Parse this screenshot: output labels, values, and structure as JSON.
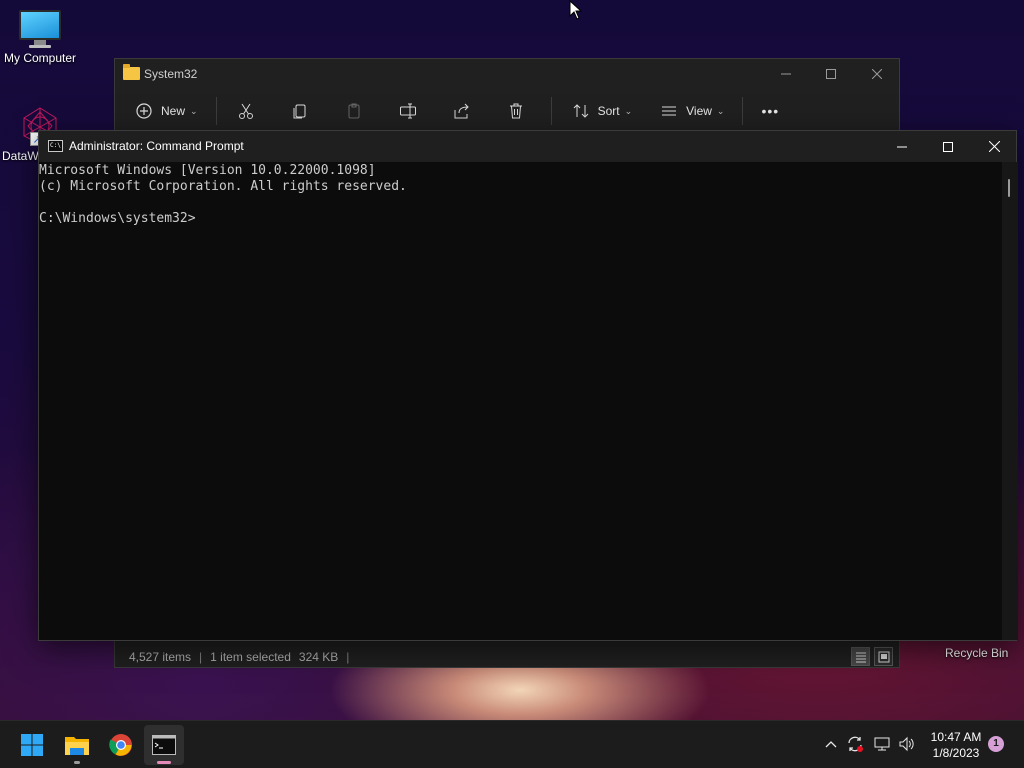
{
  "desktop": {
    "icons": [
      {
        "label": "My Computer"
      },
      {
        "label": "DataW"
      }
    ],
    "recycle_bin_label": "Recycle Bin"
  },
  "explorer": {
    "title": "System32",
    "toolbar": {
      "new_label": "New",
      "sort_label": "Sort",
      "view_label": "View",
      "more_label": "•••"
    },
    "statusbar": {
      "items_count": "4,527 items",
      "selection": "1 item selected",
      "size": "324 KB",
      "separator": "|"
    }
  },
  "cmd": {
    "title": "Administrator: Command Prompt",
    "lines": [
      "Microsoft Windows [Version 10.0.22000.1098]",
      "(c) Microsoft Corporation. All rights reserved.",
      "",
      "C:\\Windows\\system32>"
    ]
  },
  "taskbar": {
    "apps": [
      {
        "name": "Start",
        "icon": "windows-logo-icon"
      },
      {
        "name": "File Explorer",
        "icon": "folder-icon"
      },
      {
        "name": "Google Chrome",
        "icon": "chrome-icon"
      },
      {
        "name": "Command Prompt",
        "icon": "cmd-icon"
      }
    ],
    "clock": {
      "time": "10:47 AM",
      "date": "1/8/2023"
    },
    "notification_count": "1"
  },
  "colors": {
    "accent": "#e58ab8",
    "cmd_background": "#0c0c0c",
    "cmd_text": "#cccccc",
    "taskbar": "#1c1c1c",
    "explorer_background": "#202020"
  }
}
